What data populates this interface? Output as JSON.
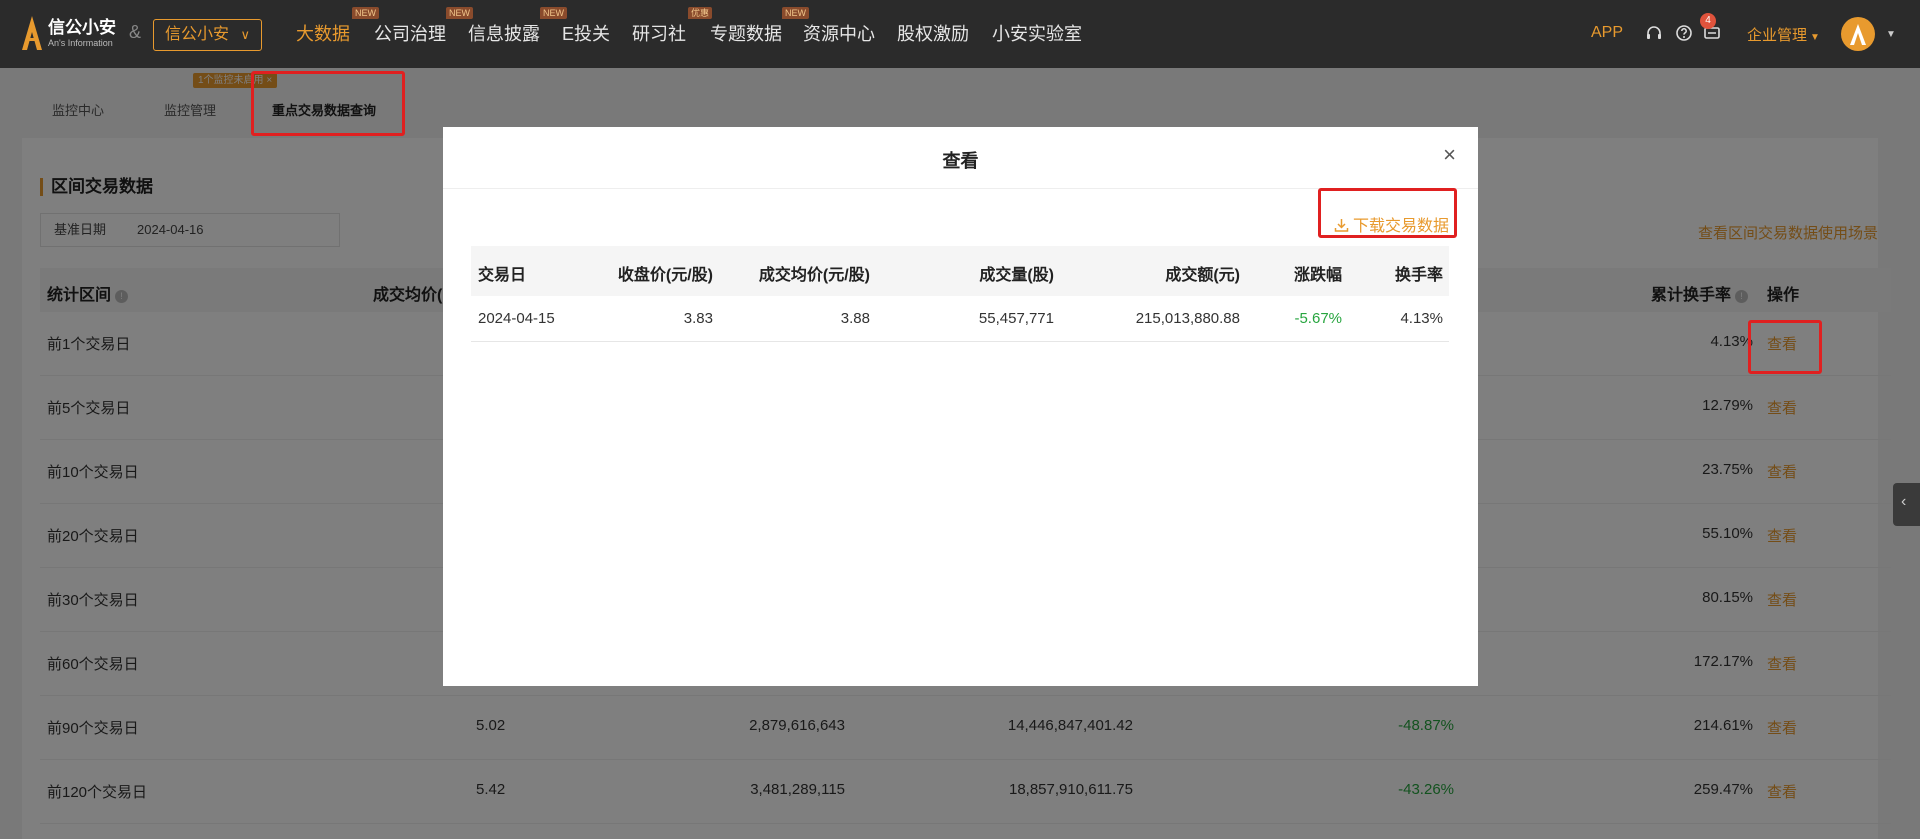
{
  "brand": {
    "name": "信公小安",
    "en": "An's Information",
    "amp": "&",
    "select": "信公小安"
  },
  "nav": {
    "items": [
      {
        "label": "大数据",
        "tag": "NEW"
      },
      {
        "label": "公司治理",
        "tag": "NEW"
      },
      {
        "label": "信息披露",
        "tag": "NEW"
      },
      {
        "label": "E投关",
        "tag": ""
      },
      {
        "label": "研习社",
        "tag": "优惠"
      },
      {
        "label": "专题数据",
        "tag": "NEW"
      },
      {
        "label": "资源中心",
        "tag": ""
      },
      {
        "label": "股权激励",
        "tag": ""
      },
      {
        "label": "小安实验室",
        "tag": ""
      }
    ],
    "app": "APP",
    "badge_count": "4",
    "corp": "企业管理",
    "icons": [
      "headset-icon",
      "help-icon",
      "message-icon"
    ]
  },
  "subtabs": [
    {
      "label": "监控中心"
    },
    {
      "label": "监控管理"
    },
    {
      "label": "重点交易数据查询",
      "active": true
    }
  ],
  "pill": "1个监控未启用",
  "pill_close": "×",
  "section": {
    "title": "区间交易数据",
    "date_label": "基准日期",
    "date_value": "2024-04-16",
    "scene_link": "查看区间交易数据使用场景"
  },
  "table": {
    "headers": {
      "period": "统计区间",
      "avg_price": "成交均价(",
      "turnover": "累计换手率",
      "action": "操作"
    },
    "rows": [
      {
        "period": "前1个交易日",
        "avg": "",
        "vol": "",
        "amt": "",
        "chg": "",
        "rate": "4.13%",
        "action": "查看"
      },
      {
        "period": "前5个交易日",
        "avg": "",
        "vol": "",
        "amt": "",
        "chg": "",
        "rate": "12.79%",
        "action": "查看"
      },
      {
        "period": "前10个交易日",
        "avg": "",
        "vol": "",
        "amt": "",
        "chg": "",
        "rate": "23.75%",
        "action": "查看"
      },
      {
        "period": "前20个交易日",
        "avg": "",
        "vol": "",
        "amt": "",
        "chg": "",
        "rate": "55.10%",
        "action": "查看"
      },
      {
        "period": "前30个交易日",
        "avg": "",
        "vol": "",
        "amt": "",
        "chg": "",
        "rate": "80.15%",
        "action": "查看"
      },
      {
        "period": "前60个交易日",
        "avg": "",
        "vol": "",
        "amt": "",
        "chg": "",
        "rate": "172.17%",
        "action": "查看"
      },
      {
        "period": "前90个交易日",
        "avg": "5.02",
        "vol": "2,879,616,643",
        "amt": "14,446,847,401.42",
        "chg": "-48.87%",
        "rate": "214.61%",
        "action": "查看"
      },
      {
        "period": "前120个交易日",
        "avg": "5.42",
        "vol": "3,481,289,115",
        "amt": "18,857,910,611.75",
        "chg": "-43.26%",
        "rate": "259.47%",
        "action": "查看"
      }
    ]
  },
  "modal": {
    "title": "查看",
    "close": "×",
    "download": "下载交易数据",
    "headers": {
      "date": "交易日",
      "close": "收盘价(元/股)",
      "avg": "成交均价(元/股)",
      "vol": "成交量(股)",
      "amt": "成交额(元)",
      "chg": "涨跌幅",
      "rate": "换手率"
    },
    "row": {
      "date": "2024-04-15",
      "close": "3.83",
      "avg": "3.88",
      "vol": "55,457,771",
      "amt": "215,013,880.88",
      "chg": "-5.67%",
      "rate": "4.13%"
    }
  },
  "colors": {
    "accent": "#e89a2e",
    "negative": "#27a53f",
    "nav_bg": "#2b2b2b",
    "annotation": "#e02020"
  }
}
